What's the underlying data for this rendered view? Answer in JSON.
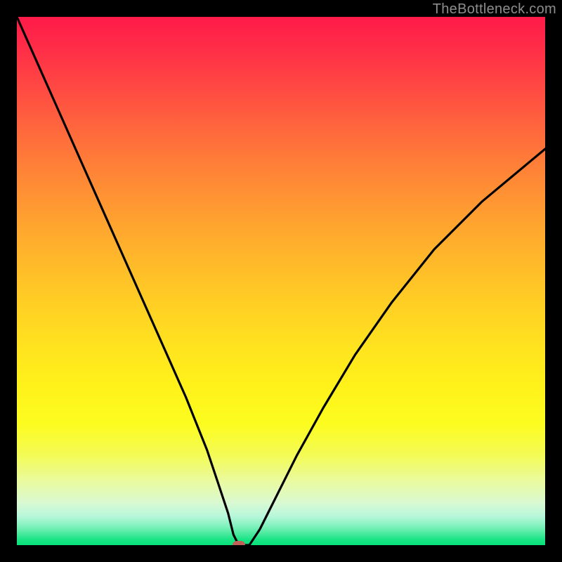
{
  "watermark": "TheBottleneck.com",
  "colors": {
    "frame": "#000000",
    "curve": "#000000",
    "marker": "#c06058",
    "watermark": "#8d8d8d"
  },
  "chart_data": {
    "type": "line",
    "title": "",
    "xlabel": "",
    "ylabel": "",
    "xlim": [
      0,
      100
    ],
    "ylim": [
      0,
      100
    ],
    "grid": false,
    "legend": false,
    "gradient_stops": [
      {
        "pos": 0,
        "color": "#ff1a49"
      },
      {
        "pos": 50,
        "color": "#ffc526"
      },
      {
        "pos": 80,
        "color": "#fcfc30"
      },
      {
        "pos": 100,
        "color": "#08e17a"
      }
    ],
    "series": [
      {
        "name": "bottleneck-curve",
        "x": [
          0,
          4,
          8,
          12,
          16,
          20,
          24,
          28,
          32,
          36,
          38,
          40,
          41,
          42,
          44,
          46,
          49,
          53,
          58,
          64,
          71,
          79,
          88,
          100
        ],
        "y": [
          100,
          91,
          82,
          73,
          64,
          55,
          46,
          37,
          28,
          18,
          12,
          6,
          2,
          0,
          0,
          3,
          9,
          17,
          26,
          36,
          46,
          56,
          65,
          75
        ]
      }
    ],
    "marker": {
      "x": 42,
      "y": 0
    }
  }
}
